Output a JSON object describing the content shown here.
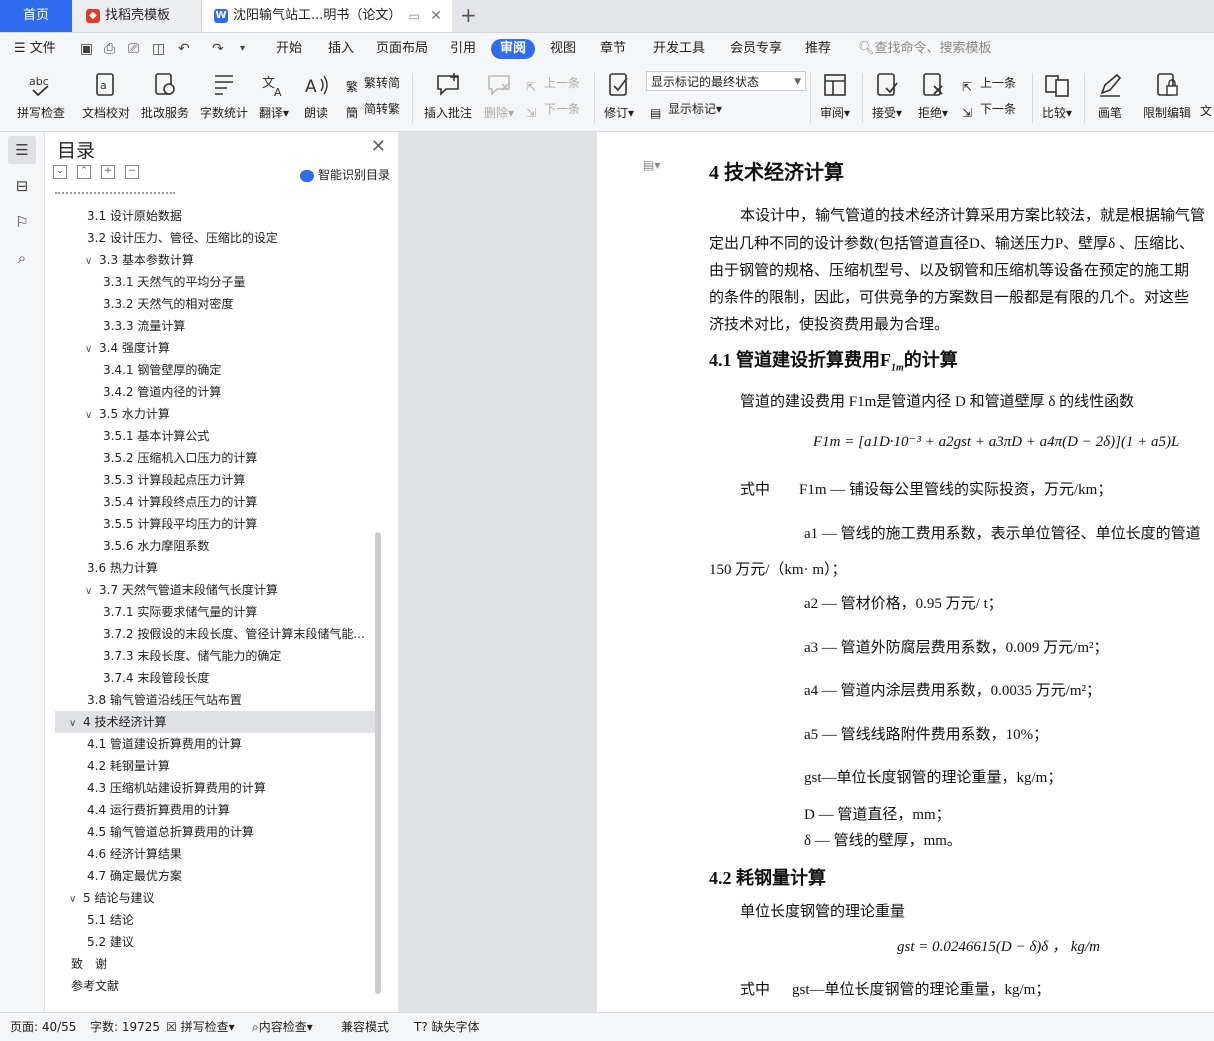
{
  "tabs": {
    "home": "首页",
    "template": "找稻壳模板",
    "document": "沈阳输气站工...明书（论文）",
    "new_tab": "+"
  },
  "menu": {
    "file": "文件",
    "items": [
      "开始",
      "插入",
      "页面布局",
      "引用",
      "审阅",
      "视图",
      "章节",
      "开发工具",
      "会员专享",
      "推荐"
    ],
    "active": "审阅",
    "search": "查找命令、搜索模板"
  },
  "ribbon": {
    "spell_check": "拼写检查",
    "doc_proof": "文档校对",
    "annotation_service": "批改服务",
    "word_count": "字数统计",
    "translate": "翻译",
    "read_aloud": "朗读",
    "to_traditional": "繁转简",
    "to_simplified": "简转繁",
    "insert_comment": "插入批注",
    "delete": "删除",
    "prev_comment": "上一条",
    "next_comment": "下一条",
    "revise": "修订",
    "markup_state": "显示标记的最终状态",
    "show_markup": "显示标记",
    "review": "审阅",
    "accept": "接受",
    "reject": "拒绝",
    "prev_change": "上一条",
    "next_change": "下一条",
    "compare": "比较",
    "pen": "画笔",
    "restrict_edit": "限制编辑",
    "more": "文"
  },
  "toc": {
    "title": "目录",
    "smart_label": "智能识别目录",
    "items": [
      {
        "text": "3.1 设计原始数据",
        "level": 2,
        "caret": ""
      },
      {
        "text": "3.2 设计压力、管径、压缩比的设定",
        "level": 2,
        "caret": ""
      },
      {
        "text": "3.3 基本参数计算",
        "level": 2,
        "caret": "∨"
      },
      {
        "text": "3.3.1 天然气的平均分子量",
        "level": 3,
        "caret": ""
      },
      {
        "text": "3.3.2 天然气的相对密度",
        "level": 3,
        "caret": ""
      },
      {
        "text": "3.3.3 流量计算",
        "level": 3,
        "caret": ""
      },
      {
        "text": "3.4 强度计算",
        "level": 2,
        "caret": "∨"
      },
      {
        "text": "3.4.1 钢管壁厚的确定",
        "level": 3,
        "caret": ""
      },
      {
        "text": "3.4.2 管道内径的计算",
        "level": 3,
        "caret": ""
      },
      {
        "text": "3.5 水力计算",
        "level": 2,
        "caret": "∨"
      },
      {
        "text": "3.5.1 基本计算公式",
        "level": 3,
        "caret": ""
      },
      {
        "text": "3.5.2 压缩机入口压力的计算",
        "level": 3,
        "caret": ""
      },
      {
        "text": "3.5.3 计算段起点压力计算",
        "level": 3,
        "caret": ""
      },
      {
        "text": "3.5.4 计算段终点压力的计算",
        "level": 3,
        "caret": ""
      },
      {
        "text": "3.5.5 计算段平均压力的计算",
        "level": 3,
        "caret": ""
      },
      {
        "text": "3.5.6 水力摩阻系数",
        "level": 3,
        "caret": ""
      },
      {
        "text": "3.6 热力计算",
        "level": 2,
        "caret": ""
      },
      {
        "text": "3.7 天然气管道末段储气长度计算",
        "level": 2,
        "caret": "∨"
      },
      {
        "text": "3.7.1 实际要求储气量的计算",
        "level": 3,
        "caret": ""
      },
      {
        "text": "3.7.2 按假设的末段长度、管径计算末段储气能...",
        "level": 3,
        "caret": ""
      },
      {
        "text": "3.7.3 末段长度、储气能力的确定",
        "level": 3,
        "caret": ""
      },
      {
        "text": "3.7.4 末段管段长度",
        "level": 3,
        "caret": ""
      },
      {
        "text": "3.8 输气管道沿线压气站布置",
        "level": 2,
        "caret": ""
      },
      {
        "text": "4 技术经济计算",
        "level": 1,
        "caret": "∨",
        "selected": true
      },
      {
        "text": "4.1 管道建设折算费用的计算",
        "level": 2,
        "caret": ""
      },
      {
        "text": "4.2 耗钢量计算",
        "level": 2,
        "caret": ""
      },
      {
        "text": "4.3 压缩机站建设折算费用的计算",
        "level": 2,
        "caret": ""
      },
      {
        "text": "4.4 运行费折算费用的计算",
        "level": 2,
        "caret": ""
      },
      {
        "text": "4.5 输气管道总折算费用的计算",
        "level": 2,
        "caret": ""
      },
      {
        "text": "4.6 经济计算结果",
        "level": 2,
        "caret": ""
      },
      {
        "text": "4.7 确定最优方案",
        "level": 2,
        "caret": ""
      },
      {
        "text": "5 结论与建议",
        "level": 1,
        "caret": "∨"
      },
      {
        "text": "5.1 结论",
        "level": 2,
        "caret": ""
      },
      {
        "text": "5.2 建议",
        "level": 2,
        "caret": ""
      },
      {
        "text": "致　谢",
        "level": 1,
        "caret": ""
      },
      {
        "text": "参考文献",
        "level": 1,
        "caret": ""
      }
    ]
  },
  "doc": {
    "h_chapter": "4 技术经济计算",
    "p1_l1": "本设计中，输气管道的技术经济计算采用方案比较法，就是根据输气管",
    "p1_l2": "定出几种不同的设计参数(包括管道直径D、输送压力P、壁厚δ 、压缩比、",
    "p1_l3": "由于钢管的规格、压缩机型号、以及钢管和压缩机等设备在预定的施工期",
    "p1_l4": "的条件的限制，因此，可供竞争的方案数目一般都是有限的几个。对这些",
    "p1_l5": "济技术对比，使投资费用最为合理。",
    "h41": "4.1 管道建设折算费用F",
    "h41_sub": "1m",
    "h41_tail": "的计算",
    "p2": "管道的建设费用 F1m是管道内径 D 和管道壁厚 δ 的线性函数",
    "formula1": "F1m = [a1D·10⁻³ + a2gst + a3πD + a4π(D − 2δ)](1 + a5)L",
    "where": "式中",
    "def_f1m": "F1m — 铺设每公里管线的实际投资，万元/km；",
    "def_a1": "a1 — 管线的施工费用系数，表示单位管径、单位长度的管道",
    "def_a1_cont": "150 万元/（km· m）；",
    "def_a2": "a2 — 管材价格，0.95 万元/ t；",
    "def_a3": "a3 — 管道外防腐层费用系数，0.009 万元/m²；",
    "def_a4": "a4 — 管道内涂层费用系数，0.0035 万元/m²；",
    "def_a5": "a5 — 管线线路附件费用系数，10%；",
    "def_gst": "gst—单位长度钢管的理论重量，kg/m；",
    "def_d": "D — 管道直径，mm；",
    "def_delta": "δ — 管线的壁厚，mm。",
    "h42": "4.2 耗钢量计算",
    "p3": "单位长度钢管的理论重量",
    "formula2": "gst = 0.0246615(D − δ)δ ， kg/m",
    "where2": "式中",
    "def_gst2": "gst—单位长度钢管的理论重量，kg/m；"
  },
  "status": {
    "page": "页面: 40/55",
    "words": "字数: 19725",
    "spell": "拼写检查",
    "content_check": "内容检查",
    "compat": "兼容模式",
    "missing_font": "缺失字体"
  },
  "colors": {
    "accent": "#2f6cf0",
    "tab_bg": "#e3e5e8",
    "toc_selected": "#dfe1e5"
  }
}
